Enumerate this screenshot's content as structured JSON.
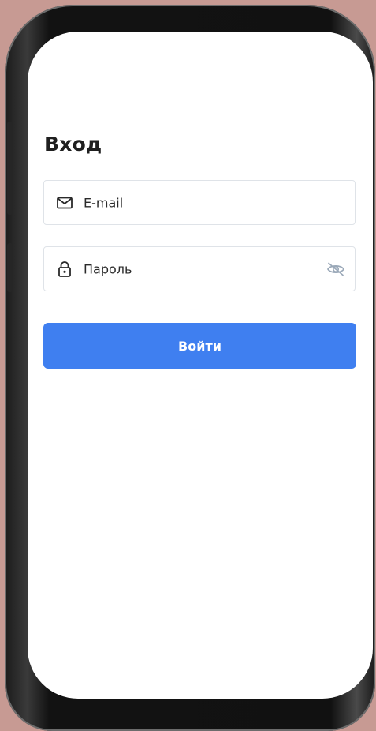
{
  "screen": {
    "title": "Вход",
    "email_field": {
      "placeholder": "E-mail",
      "icon": "mail-icon"
    },
    "password_field": {
      "placeholder": "Пароль",
      "icon": "lock-icon",
      "visibility_icon": "eye-off-icon"
    },
    "login_button": {
      "label": "Войти",
      "color": "#3f7ff0"
    }
  }
}
